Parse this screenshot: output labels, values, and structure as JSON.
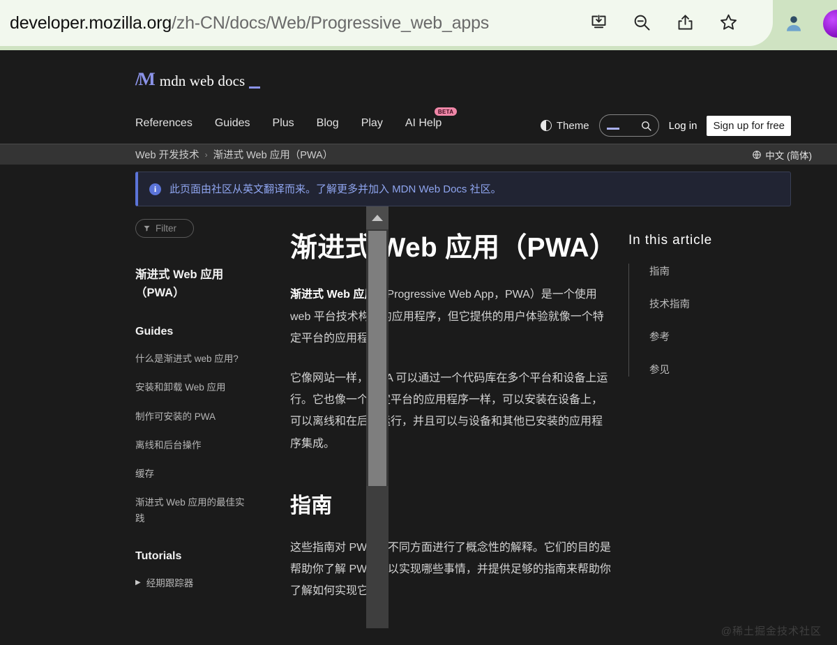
{
  "browser": {
    "url_host": "developer.mozilla.org",
    "url_path": "/zh-CN/docs/Web/Progressive_web_apps",
    "icons": [
      "install-app-icon",
      "zoom-out-icon",
      "share-icon",
      "bookmark-star-icon"
    ],
    "profile": "profile-avatar",
    "extension": "extension-icon"
  },
  "site": {
    "logo_mark": "/M",
    "logo_text": "mdn web docs",
    "nav": [
      {
        "label": "References",
        "badge": null
      },
      {
        "label": "Guides",
        "badge": null
      },
      {
        "label": "Plus",
        "badge": null
      },
      {
        "label": "Blog",
        "badge": null
      },
      {
        "label": "Play",
        "badge": null
      },
      {
        "label": "AI Help",
        "badge": "BETA"
      }
    ],
    "theme_label": "Theme",
    "search_placeholder": "",
    "login_label": "Log in",
    "signup_label": "Sign up for free"
  },
  "breadcrumb": {
    "items": [
      "Web 开发技术",
      "渐进式 Web 应用（PWA）"
    ],
    "separator": "›",
    "language": "中文 (简体)"
  },
  "notice": {
    "icon": "info-icon",
    "text": "此页面由社区从英文翻译而来。了解更多并加入 MDN Web Docs 社区。"
  },
  "sidebar": {
    "filter_placeholder": "Filter",
    "title": "渐进式 Web 应用（PWA）",
    "sections": [
      {
        "heading": "Guides",
        "items": [
          {
            "label": "什么是渐进式 web 应用?",
            "expandable": false
          },
          {
            "label": "安装和卸载 Web 应用",
            "expandable": false
          },
          {
            "label": "制作可安装的 PWA",
            "expandable": false
          },
          {
            "label": "离线和后台操作",
            "expandable": false
          },
          {
            "label": "缓存",
            "expandable": false
          },
          {
            "label": "渐进式 Web 应用的最佳实践",
            "expandable": false
          }
        ]
      },
      {
        "heading": "Tutorials",
        "items": [
          {
            "label": "经期跟踪器",
            "expandable": true,
            "caret": "▶"
          }
        ]
      }
    ]
  },
  "article": {
    "title": "渐进式 Web 应用（PWA）",
    "paragraph1_bold": "渐进式 Web 应用",
    "paragraph1_rest": "（Progressive Web App，PWA）是一个使用 web 平台技术构建的应用程序，但它提供的用户体验就像一个特定平台的应用程序。",
    "paragraph2": "它像网站一样，PWA 可以通过一个代码库在多个平台和设备上运行。它也像一个特定平台的应用程序一样，可以安装在设备上，可以离线和在后台运行，并且可以与设备和其他已安装的应用程序集成。",
    "heading2": "指南",
    "paragraph3": "这些指南对 PWA 的不同方面进行了概念性的解释。它们的目的是帮助你了解 PWA 可以实现哪些事情，并提供足够的指南来帮助你了解如何实现它们。"
  },
  "toc": {
    "title": "In this article",
    "items": [
      "指南",
      "技术指南",
      "参考",
      "参见"
    ]
  },
  "watermark": "@稀土掘金技术社区"
}
